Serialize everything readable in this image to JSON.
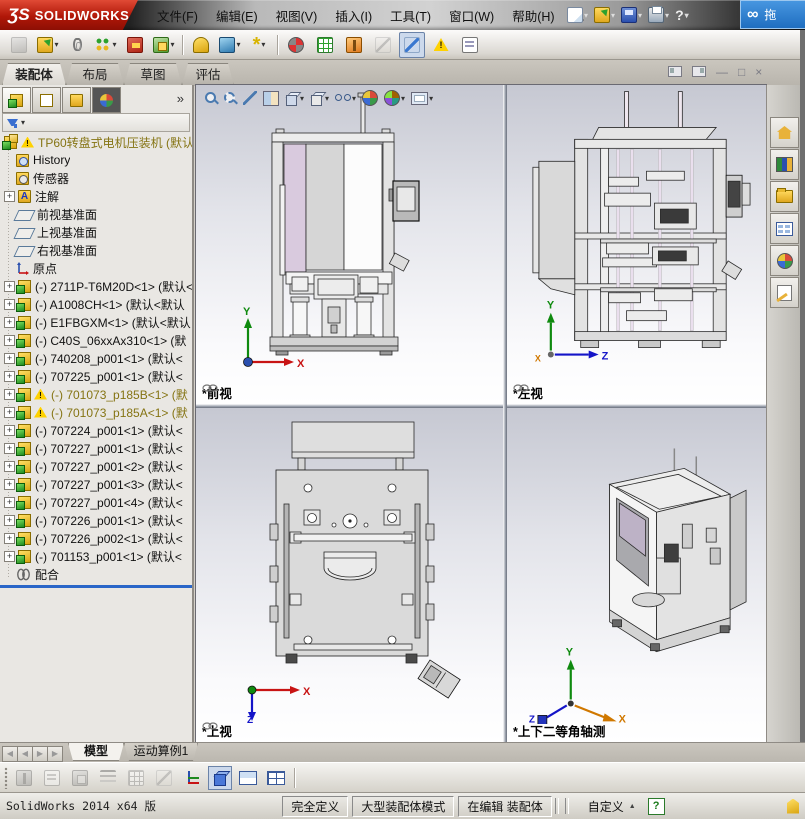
{
  "window": {
    "app_mark": "ƷS",
    "app_name": "SOLIDWORKS",
    "popup_mark": "∞",
    "popup_text": "拖"
  },
  "glyphs": {
    "caret": "▾",
    "chevron": "»",
    "minimize": "—",
    "restore": "□",
    "close": "×",
    "help": "?",
    "plus": "+",
    "warn": "!",
    "star": "*",
    "nav_first": "◀",
    "nav_prev": "◀",
    "nav_next": "▶",
    "nav_last": "▶",
    "custom_arrow": "▲"
  },
  "menubar": {
    "items": [
      "文件(F)",
      "编辑(E)",
      "视图(V)",
      "插入(I)",
      "工具(T)",
      "窗口(W)",
      "帮助(H)"
    ],
    "quick_icons": [
      "new-document",
      "open",
      "save",
      "print",
      "help"
    ]
  },
  "toolbar": {
    "icons": [
      "edit-component",
      "insert-components",
      "mate",
      "linear-component-pattern",
      "smart-fasteners",
      "move-component",
      "assembly-features",
      "reference-geometry",
      "sketch",
      "new-motion-study",
      "bill-of-materials",
      "exploded-view",
      "explode-line-sketch",
      "interference-detection",
      "assembly-xpert",
      "component-preview-window"
    ]
  },
  "command_tabs": {
    "items": [
      "装配体",
      "布局",
      "草图",
      "评估"
    ],
    "active_index": 0
  },
  "left_panel": {
    "pane_tabs": [
      "featuremanager",
      "propertymanager",
      "configurationmanager",
      "displaymanager"
    ],
    "filter_icon": "filter-funnel",
    "tree": {
      "items": [
        {
          "icon": "assembly",
          "warn": true,
          "label": "TP60转盘式电机压装机 ",
          "suffix": "(默认"
        },
        {
          "icon": "history-folder",
          "label": "History",
          "suffix": ""
        },
        {
          "icon": "sensors-folder",
          "label": "传感器",
          "suffix": ""
        },
        {
          "icon": "annotations-folder",
          "expand": true,
          "label": "注解",
          "suffix": ""
        },
        {
          "icon": "reference-plane",
          "label": "前视基准面",
          "suffix": ""
        },
        {
          "icon": "reference-plane",
          "label": "上视基准面",
          "suffix": ""
        },
        {
          "icon": "reference-plane",
          "label": "右视基准面",
          "suffix": ""
        },
        {
          "icon": "origin",
          "label": "原点",
          "suffix": ""
        },
        {
          "icon": "part",
          "expand": true,
          "label": "(-) 2711P-T6M20D<1> ",
          "suffix": "(默认<"
        },
        {
          "icon": "part",
          "expand": true,
          "label": "(-) A1008CH<1> ",
          "suffix": "(默认<默认"
        },
        {
          "icon": "part",
          "expand": true,
          "label": "(-) E1FBGXM<1> ",
          "suffix": "(默认<默认"
        },
        {
          "icon": "part",
          "expand": true,
          "label": "(-) C40S_06xxAx310<1> ",
          "suffix": "(默"
        },
        {
          "icon": "part",
          "expand": true,
          "label": "(-) 740208_p001<1> ",
          "suffix": "(默认<"
        },
        {
          "icon": "part",
          "expand": true,
          "label": "(-) 707225_p001<1> ",
          "suffix": "(默认<"
        },
        {
          "icon": "part",
          "expand": true,
          "warn": true,
          "label": "(-) 701073_p185B<1> ",
          "suffix": "(默"
        },
        {
          "icon": "part",
          "expand": true,
          "warn": true,
          "label": "(-) 701073_p185A<1> ",
          "suffix": "(默"
        },
        {
          "icon": "part",
          "expand": true,
          "label": "(-) 707224_p001<1> ",
          "suffix": "(默认<"
        },
        {
          "icon": "part",
          "expand": true,
          "label": "(-) 707227_p001<1> ",
          "suffix": "(默认<"
        },
        {
          "icon": "part",
          "expand": true,
          "label": "(-) 707227_p001<2> ",
          "suffix": "(默认<"
        },
        {
          "icon": "part",
          "expand": true,
          "label": "(-) 707227_p001<3> ",
          "suffix": "(默认<"
        },
        {
          "icon": "part",
          "expand": true,
          "label": "(-) 707227_p001<4> ",
          "suffix": "(默认<"
        },
        {
          "icon": "part",
          "expand": true,
          "label": "(-) 707226_p001<1> ",
          "suffix": "(默认<"
        },
        {
          "icon": "part",
          "expand": true,
          "label": "(-) 707226_p002<1> ",
          "suffix": "(默认<"
        },
        {
          "icon": "part",
          "expand": true,
          "label": "(-) 701153_p001<1> ",
          "suffix": "(默认<"
        },
        {
          "icon": "mates",
          "label": "配合",
          "suffix": ""
        }
      ]
    }
  },
  "headsup": [
    "zoom-to-fit",
    "zoom-to-area",
    "view-selector",
    "section-view",
    "view-orientation",
    "display-style",
    "hide-show-items",
    "edit-appearance",
    "apply-scene",
    "view-settings"
  ],
  "viewports": [
    {
      "label": "*前视",
      "linked": true,
      "axes": {
        "up": "Y",
        "right": "X"
      }
    },
    {
      "label": "*左视",
      "linked": true,
      "axes": {
        "up": "Y",
        "right": "Z",
        "extra": "X"
      }
    },
    {
      "label": "*上视",
      "linked": true,
      "axes": {
        "right": "X",
        "down": "Z"
      }
    },
    {
      "label": "*上下二等角轴测",
      "linked": false,
      "axes": {
        "up": "Y",
        "right": "X",
        "left": "Z"
      }
    }
  ],
  "task_pane": [
    "solidworks-resources",
    "design-library",
    "file-explorer",
    "view-palette",
    "appearances-scenes",
    "custom-properties"
  ],
  "bottom_tabs": {
    "tabs": [
      "模型",
      "运动算例1"
    ],
    "active_index": 0
  },
  "display_toolbar": [
    "stacked-views",
    "layer-properties",
    "format-painter",
    "line-format",
    "grid-settings",
    "reverse-direction",
    "coordinate-axes-toggle",
    "single-view",
    "two-view",
    "four-view"
  ],
  "statusbar": {
    "version": "SolidWorks 2014 x64 版",
    "fields": [
      "完全定义",
      "大型装配体模式",
      "在编辑 装配体"
    ],
    "custom_label": "自定义"
  },
  "colors": {
    "logo_red": "#b01708",
    "popup_blue": "#2f81d6",
    "warn_yellow": "#ffd200",
    "lightweight_text": "#857413",
    "rollback_blue": "#2a66c8",
    "viewport_gradient_top": "#c6c8d2",
    "viewport_gradient_bottom": "#ffffff"
  }
}
